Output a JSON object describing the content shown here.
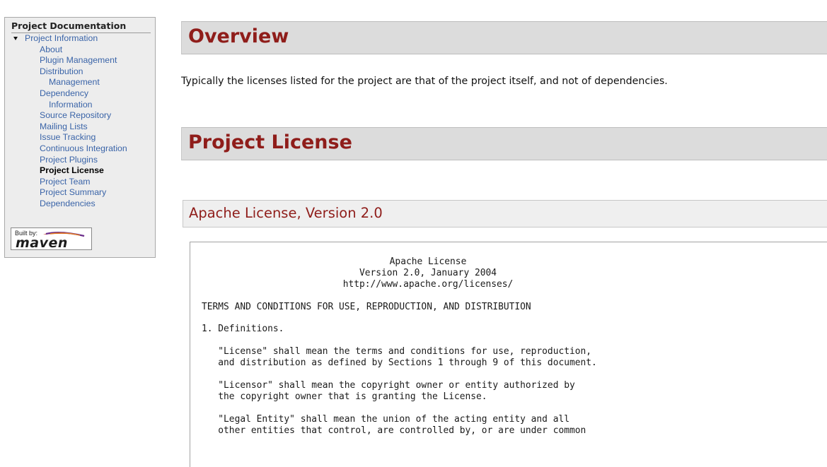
{
  "sidebar": {
    "title": "Project Documentation",
    "root": "Project Information",
    "items": [
      {
        "label": "About",
        "level": 1
      },
      {
        "label": "Plugin Management",
        "level": 1
      },
      {
        "label": "Distribution",
        "level": 1
      },
      {
        "label": "Management",
        "level": 2
      },
      {
        "label": "Dependency",
        "level": 1
      },
      {
        "label": "Information",
        "level": 2
      },
      {
        "label": "Source Repository",
        "level": 1
      },
      {
        "label": "Mailing Lists",
        "level": 1
      },
      {
        "label": "Issue Tracking",
        "level": 1
      },
      {
        "label": "Continuous Integration",
        "level": 1
      },
      {
        "label": "Project Plugins",
        "level": 1
      },
      {
        "label": "Project License",
        "level": 1,
        "active": true
      },
      {
        "label": "Project Team",
        "level": 1
      },
      {
        "label": "Project Summary",
        "level": 1
      },
      {
        "label": "Dependencies",
        "level": 1
      }
    ],
    "badge": {
      "built_by": "Built by:",
      "word": "maven"
    }
  },
  "main": {
    "overview_title": "Overview",
    "overview_text": "Typically the licenses listed for the project are that of the project itself, and not of dependencies.",
    "license_title": "Project License",
    "apache_title": "Apache License, Version 2.0",
    "license_header": [
      "Apache License",
      "Version 2.0, January 2004",
      "http://www.apache.org/licenses/"
    ],
    "license_body": [
      "",
      "TERMS AND CONDITIONS FOR USE, REPRODUCTION, AND DISTRIBUTION",
      "",
      "1. Definitions.",
      "",
      "   \"License\" shall mean the terms and conditions for use, reproduction,",
      "   and distribution as defined by Sections 1 through 9 of this document.",
      "",
      "   \"Licensor\" shall mean the copyright owner or entity authorized by",
      "   the copyright owner that is granting the License.",
      "",
      "   \"Legal Entity\" shall mean the union of the acting entity and all",
      "   other entities that control, are controlled by, or are under common"
    ]
  },
  "colors": {
    "heading": "#8f1d1a",
    "link": "#3a64a8",
    "header_bg": "#dcdcdc",
    "sidebar_bg": "#ededed"
  }
}
